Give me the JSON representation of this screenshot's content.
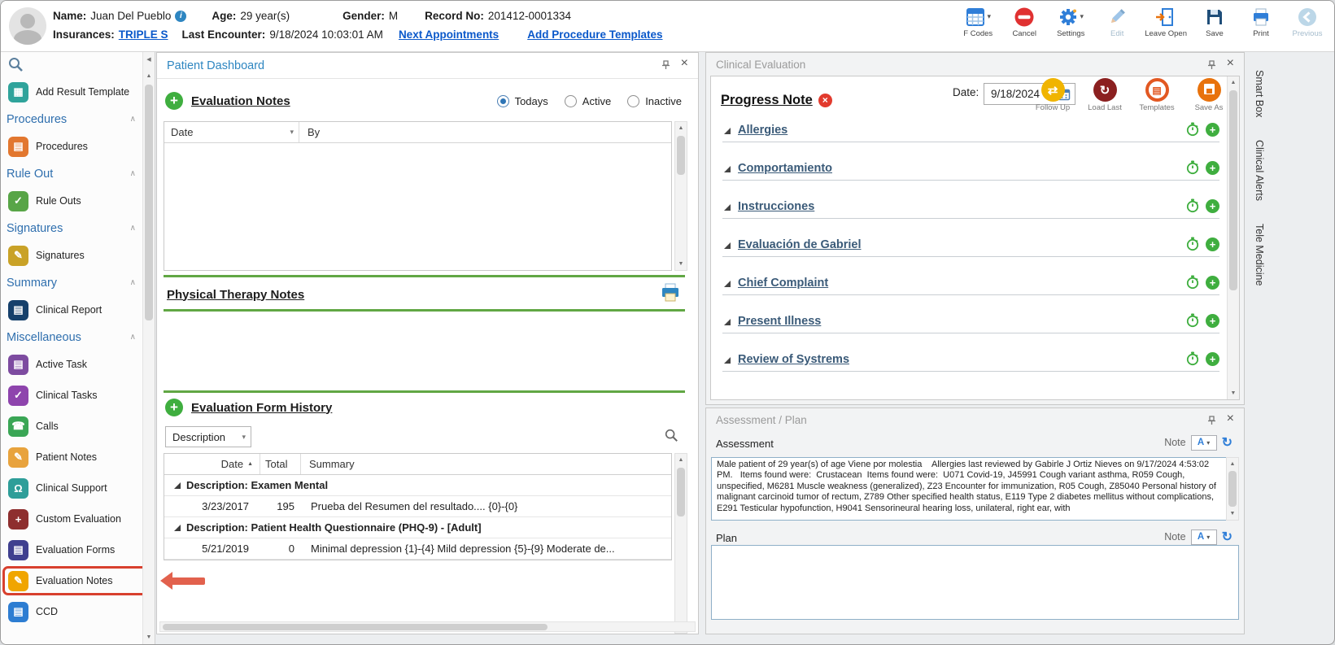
{
  "patient_header": {
    "name_label": "Name:",
    "name": "Juan Del Pueblo",
    "age_label": "Age:",
    "age": "29 year(s)",
    "gender_label": "Gender:",
    "gender": "M",
    "record_label": "Record No:",
    "record_number": "201412-0001334",
    "insurances_label": "Insurances:",
    "insurance": "TRIPLE S",
    "last_encounter_label": "Last Encounter:",
    "last_encounter": "9/18/2024 10:03:01 AM",
    "next_appointments_link": "Next Appointments",
    "add_procedure_templates_link": "Add Procedure Templates",
    "toolbar": [
      {
        "label": "F Codes"
      },
      {
        "label": "Cancel"
      },
      {
        "label": "Settings"
      },
      {
        "label": "Edit"
      },
      {
        "label": "Leave Open"
      },
      {
        "label": "Save"
      },
      {
        "label": "Print"
      },
      {
        "label": "Previous"
      }
    ]
  },
  "sidebar": {
    "entries": [
      {
        "is_item": true,
        "label": "Add Result Template",
        "glyph": "▦",
        "color": "#2fa39b"
      },
      {
        "is_header": true,
        "label": "Procedures"
      },
      {
        "is_item": true,
        "label": "Procedures",
        "glyph": "▤",
        "color": "#e2772f"
      },
      {
        "is_header": true,
        "label": "Rule Out"
      },
      {
        "is_item": true,
        "label": "Rule Outs",
        "glyph": "✓",
        "color": "#58a547"
      },
      {
        "is_header": true,
        "label": "Signatures"
      },
      {
        "is_item": true,
        "label": "Signatures",
        "glyph": "✎",
        "color": "#c9a227"
      },
      {
        "is_header": true,
        "label": "Summary"
      },
      {
        "is_item": true,
        "label": "Clinical Report",
        "glyph": "▤",
        "color": "#15406b"
      },
      {
        "is_header": true,
        "label": "Miscellaneous"
      },
      {
        "is_item": true,
        "label": "Active Task",
        "glyph": "▤",
        "color": "#7d4ba0"
      },
      {
        "is_item": true,
        "label": "Clinical Tasks",
        "glyph": "✓",
        "color": "#8e44ad"
      },
      {
        "is_item": true,
        "label": "Calls",
        "glyph": "☎",
        "color": "#3aa655"
      },
      {
        "is_item": true,
        "label": "Patient Notes",
        "glyph": "✎",
        "color": "#e8a33d"
      },
      {
        "is_item": true,
        "label": "Clinical Support",
        "glyph": "Ω",
        "color": "#2e9e99"
      },
      {
        "is_item": true,
        "label": "Custom Evaluation",
        "glyph": "+",
        "color": "#8e2f2f"
      },
      {
        "is_item": true,
        "label": "Evaluation Forms",
        "glyph": "▤",
        "color": "#3f3f8f"
      },
      {
        "is_item": true,
        "label": "Evaluation Notes",
        "glyph": "✎",
        "color": "#f0a500",
        "selected": true
      },
      {
        "is_item": true,
        "label": "CCD",
        "glyph": "▤",
        "color": "#2d7dd2"
      }
    ]
  },
  "patient_dashboard": {
    "title": "Patient Dashboard",
    "evaluation_notes": {
      "title": "Evaluation Notes",
      "radios": [
        {
          "label": "Todays",
          "on": true
        },
        {
          "label": "Active"
        },
        {
          "label": "Inactive"
        }
      ],
      "columns": [
        "Date",
        "By"
      ]
    },
    "physical_therapy_title": "Physical Therapy Notes",
    "form_history": {
      "title": "Evaluation Form History",
      "filter_value": "Description",
      "columns": [
        "Date",
        "Total",
        "Summary"
      ],
      "rows": [
        {
          "is_group": true,
          "label": "Description: Examen Mental"
        },
        {
          "is_row": true,
          "date": "3/23/2017",
          "total": "195",
          "summary": "Prueba del Resumen del resultado.... {0}-{0}"
        },
        {
          "is_group": true,
          "label": "Description: Patient Health Questionnaire (PHQ-9) - [Adult]"
        },
        {
          "is_row": true,
          "date": "5/21/2019",
          "total": "0",
          "summary": "Minimal depression {1}-{4}  Mild depression {5}-{9}  Moderate de..."
        }
      ]
    }
  },
  "clinical_evaluation": {
    "panel_title": "Clinical Evaluation",
    "note_title": "Progress Note",
    "date_label": "Date:",
    "date_value": "9/18/2024",
    "actions": [
      {
        "label": "Follow Up"
      },
      {
        "label": "Load Last"
      },
      {
        "label": "Templates"
      },
      {
        "label": "Save As"
      }
    ],
    "sections": [
      {
        "title": "Allergies"
      },
      {
        "title": "Comportamiento"
      },
      {
        "title": "Instrucciones"
      },
      {
        "title": "Evaluación de Gabriel"
      },
      {
        "title": "Chief Complaint"
      },
      {
        "title": "Present Illness"
      },
      {
        "title": "Review of Systrems"
      }
    ]
  },
  "assessment_plan": {
    "panel_title": "Assessment / Plan",
    "assessment_label": "Assessment",
    "plan_label": "Plan",
    "note_label": "Note",
    "note_letter": "A",
    "assessment_text": "Male patient of 29 year(s) of age Viene por molestia    Allergies last reviewed by Gabirle J Ortiz Nieves on 9/17/2024 4:53:02 PM.   Items found were:  Crustacean  Items found were:  U071 Covid-19, J45991 Cough variant asthma, R059 Cough, unspecified, M6281 Muscle weakness (generalized), Z23 Encounter for immunization, R05 Cough, Z85040 Personal history of malignant carcinoid tumor of rectum, Z789 Other specified health status, E119 Type 2 diabetes mellitus without complications, E291 Testicular hypofunction, H9041 Sensorineural hearing loss, unilateral, right ear, with",
    "plan_text": ""
  },
  "right_tabs": [
    "Smart Box",
    "Clinical Alerts",
    "Tele Medicine"
  ]
}
